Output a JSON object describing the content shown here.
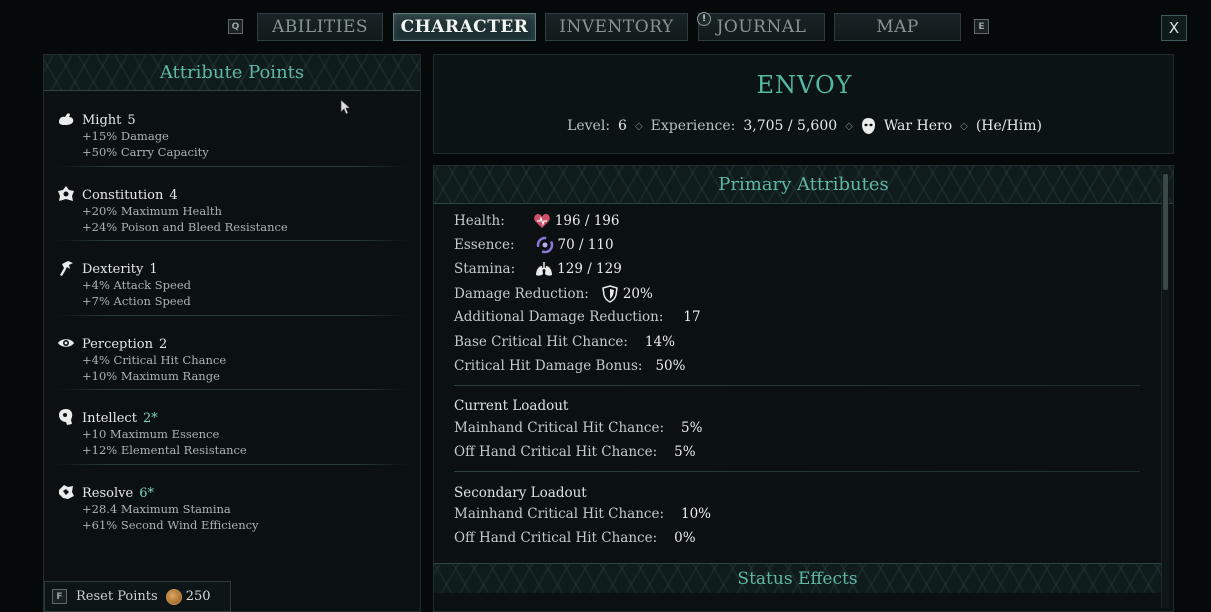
{
  "nav": {
    "key_left": "Q",
    "key_right": "E",
    "tabs": [
      {
        "label": "ABILITIES"
      },
      {
        "label": "CHARACTER"
      },
      {
        "label": "INVENTORY"
      },
      {
        "label": "JOURNAL"
      },
      {
        "label": "MAP"
      }
    ],
    "active_tab": "CHARACTER",
    "journal_notice": "!",
    "close_label": "X"
  },
  "attribute_points": {
    "title": "Attribute Points",
    "attributes": [
      {
        "name": "Might",
        "value": "5",
        "lines": [
          "+15% Damage",
          "+50% Carry Capacity"
        ],
        "icon": "might-icon"
      },
      {
        "name": "Constitution",
        "value": "4",
        "lines": [
          "+20% Maximum Health",
          "+24% Poison and Bleed Resistance"
        ],
        "icon": "constitution-icon"
      },
      {
        "name": "Dexterity",
        "value": "1",
        "lines": [
          "+4% Attack Speed",
          "+7% Action Speed"
        ],
        "icon": "dexterity-icon"
      },
      {
        "name": "Perception",
        "value": "2",
        "lines": [
          "+4% Critical Hit Chance",
          "+10% Maximum Range"
        ],
        "icon": "perception-icon"
      },
      {
        "name": "Intellect",
        "value": "2*",
        "lines": [
          "+10 Maximum Essence",
          "+12% Elemental Resistance"
        ],
        "icon": "intellect-icon"
      },
      {
        "name": "Resolve",
        "value": "6*",
        "lines": [
          "+28.4 Maximum Stamina",
          "+61% Second Wind Efficiency"
        ],
        "icon": "resolve-icon"
      }
    ],
    "reset": {
      "key": "F",
      "label": "Reset Points",
      "cost": "250"
    }
  },
  "character": {
    "name": "ENVOY",
    "level_label": "Level:",
    "level": "6",
    "exp_label": "Experience:",
    "exp": "3,705 / 5,600",
    "background": "War Hero",
    "pronouns": "(He/Him)"
  },
  "primary": {
    "title": "Primary Attributes",
    "health_label": "Health:",
    "health": "196 / 196",
    "essence_label": "Essence:",
    "essence": "70 / 110",
    "stamina_label": "Stamina:",
    "stamina": "129 / 129",
    "dr_label": "Damage Reduction:",
    "dr": "20%",
    "adr_label": "Additional Damage Reduction:",
    "adr": "17",
    "bcc_label": "Base Critical Hit Chance:",
    "bcc": "14%",
    "chd_label": "Critical Hit Damage Bonus:",
    "chd": "50%",
    "current_loadout": {
      "title": "Current Loadout",
      "main_label": "Mainhand Critical Hit Chance:",
      "main": "5%",
      "off_label": "Off Hand Critical Hit Chance:",
      "off": "5%"
    },
    "secondary_loadout": {
      "title": "Secondary Loadout",
      "main_label": "Mainhand Critical Hit Chance:",
      "main": "10%",
      "off_label": "Off Hand Critical Hit Chance:",
      "off": "0%"
    },
    "status_title": "Status Effects"
  },
  "colors": {
    "accent": "#5fb8a6",
    "boost": "#7fd1bd",
    "background": "#06090a"
  }
}
